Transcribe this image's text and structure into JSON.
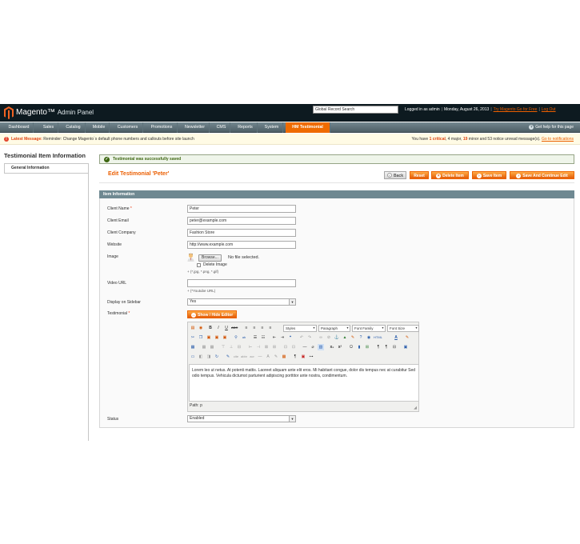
{
  "header": {
    "logo_brand": "Magento",
    "logo_sub": "Admin Panel",
    "search_value": "Global Record Search",
    "logged_in": "Logged in as admin",
    "date": "Monday, August 26, 2013",
    "try_link": "Try Magento Go for Free",
    "logout": "Log Out"
  },
  "nav": {
    "items": [
      {
        "label": "Dashboard"
      },
      {
        "label": "Sales"
      },
      {
        "label": "Catalog"
      },
      {
        "label": "Mobile"
      },
      {
        "label": "Customers"
      },
      {
        "label": "Promotions"
      },
      {
        "label": "Newsletter"
      },
      {
        "label": "CMS"
      },
      {
        "label": "Reports"
      },
      {
        "label": "System"
      },
      {
        "label": "HM Testimonial"
      }
    ],
    "help": "Get help for this page",
    "help_icon": "?"
  },
  "notice": {
    "icon": "!",
    "label": "Latest Message:",
    "text": "Reminder: Change Magento`s default phone numbers and callouts before site launch",
    "pre": "You have",
    "critical_count": "1 critical",
    "major": ", 4 major, ",
    "minor_count": "19",
    "rest": " minor and 53 notice unread message(s).",
    "link": "Go to notifications"
  },
  "sidebar": {
    "title": "Testimonial Item Information",
    "tab": "General Information"
  },
  "messages": {
    "success_icon": "✓",
    "success": "Testimonial was successfully saved"
  },
  "page": {
    "title": "Edit Testimonial 'Peter'"
  },
  "buttons": {
    "back": "Back",
    "back_icon": "‹",
    "reset": "Reset",
    "delete": "Delete Item",
    "delete_icon": "×",
    "save": "Save Item",
    "save_icon": "›",
    "save_continue": "Save And Continue Edit",
    "save_continue_icon": "›"
  },
  "form": {
    "section_title": "Item Information",
    "client_name_label": "Client Name",
    "required_mark": "*",
    "client_name": "Peter",
    "client_email_label": "Client Email",
    "client_email": "peter@example.com",
    "client_company_label": "Client Company",
    "client_company": "Fashion Store",
    "website_label": "Website",
    "website": "http://www.example.com",
    "image_label": "Image",
    "browse": "Browse...",
    "no_file": "No file selected.",
    "delete_image": "Delete Image",
    "image_note": "(*.jpg, *.png, *.gif)",
    "video_label": "Video URL",
    "video_value": "",
    "video_note": "(*Youtube URL)",
    "sidebar_label": "Display on Sidebar",
    "sidebar_value": "Yes",
    "testimonial_label": "Testimonial",
    "show_hide": "Show / Hide Editor",
    "status_label": "Status",
    "status_value": "Enabled"
  },
  "editor": {
    "styles": "Styles",
    "paragraph": "Paragraph",
    "font_family": "Font Family",
    "font_size": "Font Size",
    "content": "Lorem leo ut netus. At potenti mattis. Laoreet aliquam ante elit eros. Mi habitant congue, dolor dis tempus nec at curabitur Sed odio tempus. Vehicula dictumst parturient adipiscing porttitor ante nostra, condimentum.",
    "path": "Path: p",
    "toolbar_icons": [
      "html-icon",
      "preview-icon",
      "bold-icon",
      "italic-icon",
      "underline-icon",
      "strikethrough-icon",
      "align-left-icon",
      "align-center-icon",
      "align-right-icon",
      "align-justify-icon"
    ]
  }
}
